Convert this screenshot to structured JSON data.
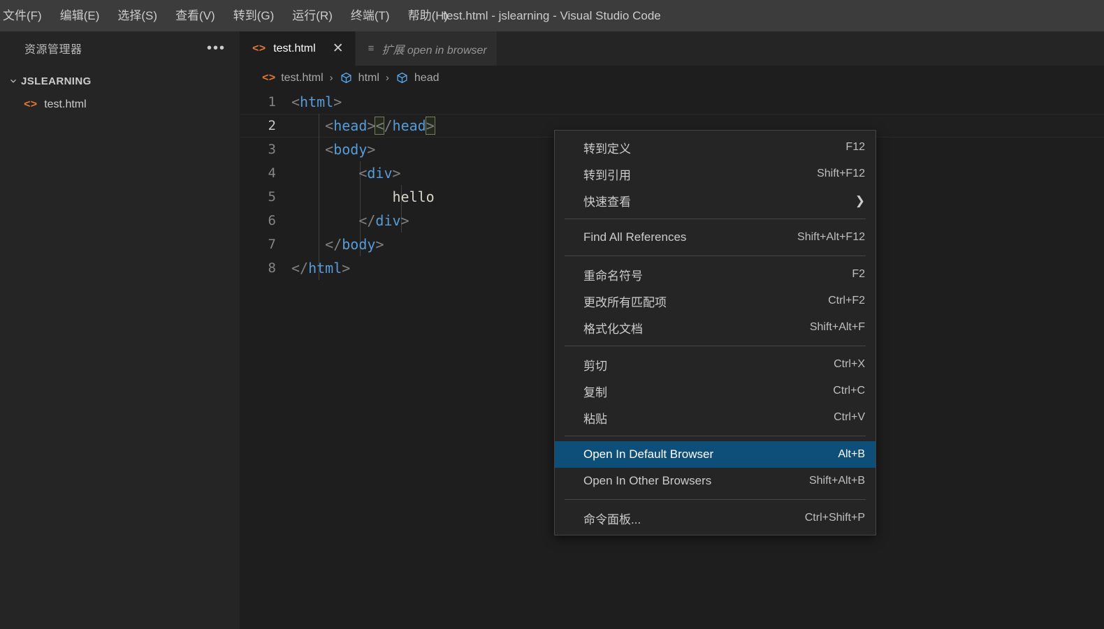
{
  "window": {
    "title": "test.html - jslearning - Visual Studio Code"
  },
  "menubar": {
    "items": [
      {
        "label": "文件(F)"
      },
      {
        "label": "编辑(E)"
      },
      {
        "label": "选择(S)"
      },
      {
        "label": "查看(V)"
      },
      {
        "label": "转到(G)"
      },
      {
        "label": "运行(R)"
      },
      {
        "label": "终端(T)"
      },
      {
        "label": "帮助(H)"
      }
    ]
  },
  "sidebar": {
    "title": "资源管理器",
    "actions_icon": "ellipsis-icon",
    "tree": {
      "folder": {
        "label": "JSLEARNING",
        "expanded": true
      },
      "files": [
        {
          "label": "test.html",
          "icon": "html-file-icon",
          "icon_glyph": "<>"
        }
      ]
    }
  },
  "tabs": [
    {
      "label": "test.html",
      "icon": "html-file-icon",
      "icon_glyph": "<>",
      "active": true,
      "close_glyph": "✕"
    },
    {
      "label": "扩展 open in browser",
      "icon": "extension-list-icon",
      "icon_glyph": "≡",
      "active": false,
      "preview": true
    }
  ],
  "breadcrumb": {
    "separator": "›",
    "segments": [
      {
        "label": "test.html",
        "icon": "html-file-icon"
      },
      {
        "label": "html",
        "icon": "symbol-cube-icon"
      },
      {
        "label": "head",
        "icon": "symbol-cube-icon"
      }
    ]
  },
  "editor": {
    "current_line": 2,
    "lines": [
      {
        "no": "1",
        "text": "<html>"
      },
      {
        "no": "2",
        "text": "    <head></head>"
      },
      {
        "no": "3",
        "text": "    <body>"
      },
      {
        "no": "4",
        "text": "        <div>"
      },
      {
        "no": "5",
        "text": "            hello"
      },
      {
        "no": "6",
        "text": "        </div>"
      },
      {
        "no": "7",
        "text": "    </body>"
      },
      {
        "no": "8",
        "text": "</html>"
      }
    ]
  },
  "context_menu": {
    "items": [
      {
        "label": "转到定义",
        "key": "F12",
        "type": "item"
      },
      {
        "label": "转到引用",
        "key": "Shift+F12",
        "type": "item"
      },
      {
        "label": "快速查看",
        "key": "",
        "type": "submenu",
        "submenu_glyph": "❯"
      },
      {
        "type": "separator"
      },
      {
        "label": "Find All References",
        "key": "Shift+Alt+F12",
        "type": "item"
      },
      {
        "type": "separator"
      },
      {
        "label": "重命名符号",
        "key": "F2",
        "type": "item"
      },
      {
        "label": "更改所有匹配项",
        "key": "Ctrl+F2",
        "type": "item"
      },
      {
        "label": "格式化文档",
        "key": "Shift+Alt+F",
        "type": "item"
      },
      {
        "type": "separator"
      },
      {
        "label": "剪切",
        "key": "Ctrl+X",
        "type": "item"
      },
      {
        "label": "复制",
        "key": "Ctrl+C",
        "type": "item"
      },
      {
        "label": "粘贴",
        "key": "Ctrl+V",
        "type": "item"
      },
      {
        "type": "separator"
      },
      {
        "label": "Open In Default Browser",
        "key": "Alt+B",
        "type": "item",
        "selected": true
      },
      {
        "label": "Open In Other Browsers",
        "key": "Shift+Alt+B",
        "type": "item"
      },
      {
        "type": "separator"
      },
      {
        "label": "命令面板...",
        "key": "Ctrl+Shift+P",
        "type": "item"
      }
    ]
  },
  "colors": {
    "titlebar_bg": "#3c3c3c",
    "sidebar_bg": "#252526",
    "editor_bg": "#1e1e1e",
    "menu_bg": "#252526",
    "menu_selected_bg": "#0d4f79",
    "tag_color": "#569cd6",
    "punct_color": "#808080",
    "html_icon_color": "#e37933",
    "progress_accent": "#6c6cc4"
  }
}
